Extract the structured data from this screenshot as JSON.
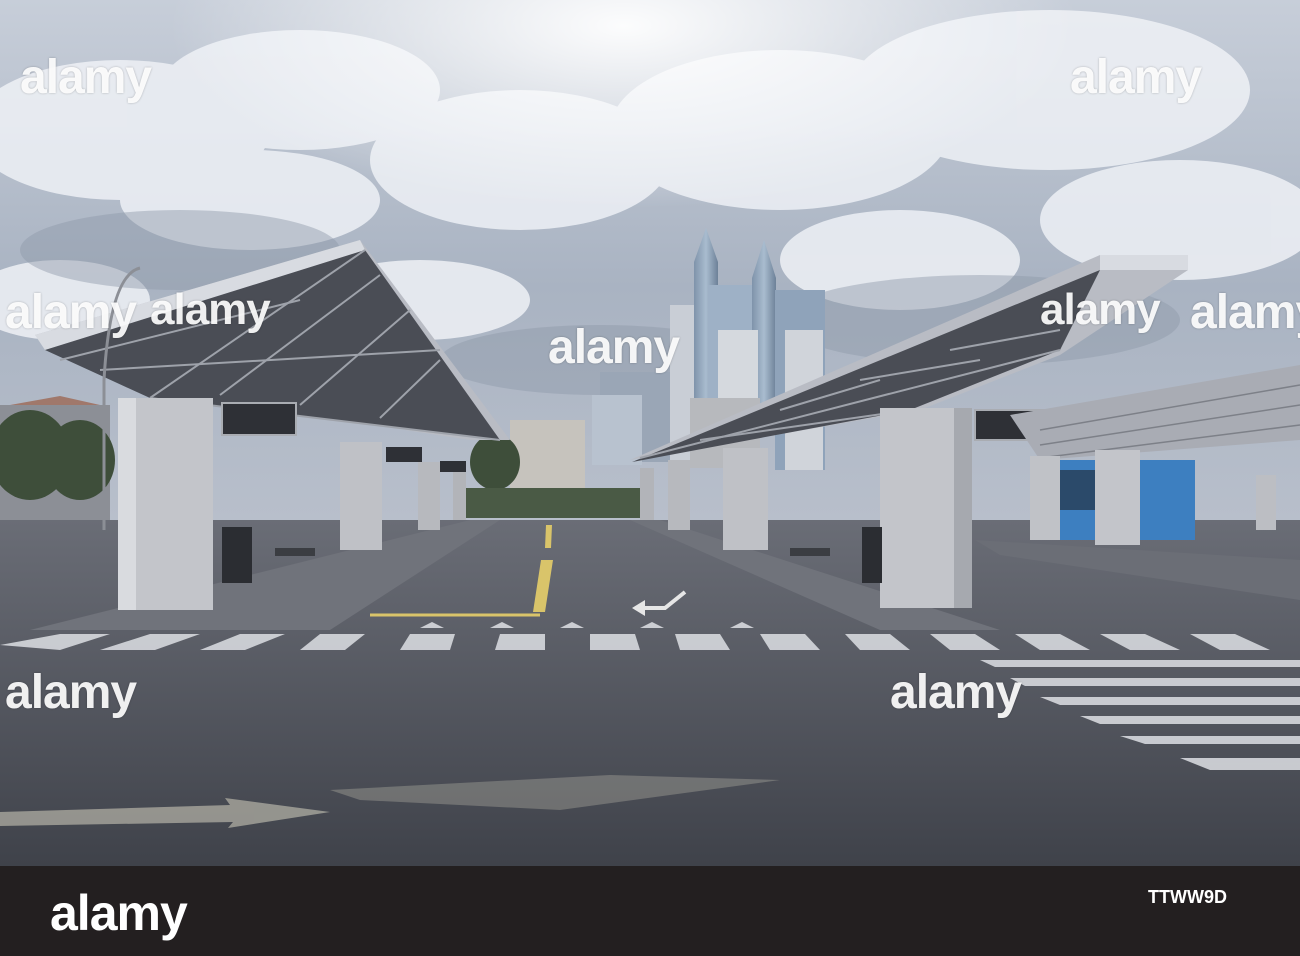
{
  "image": {
    "watermark_text": "alamy",
    "footer": {
      "brand": "alamy",
      "image_id": "TTWW9D"
    },
    "colors": {
      "sky": "#b9c3d2",
      "cloud": "#eef1f6",
      "asphalt": "#53565f",
      "canopy": "#c9ccd4",
      "pillar": "#c2c4c9",
      "footer_bg": "#231f20",
      "bus_blue": "#3d7fc0"
    }
  }
}
